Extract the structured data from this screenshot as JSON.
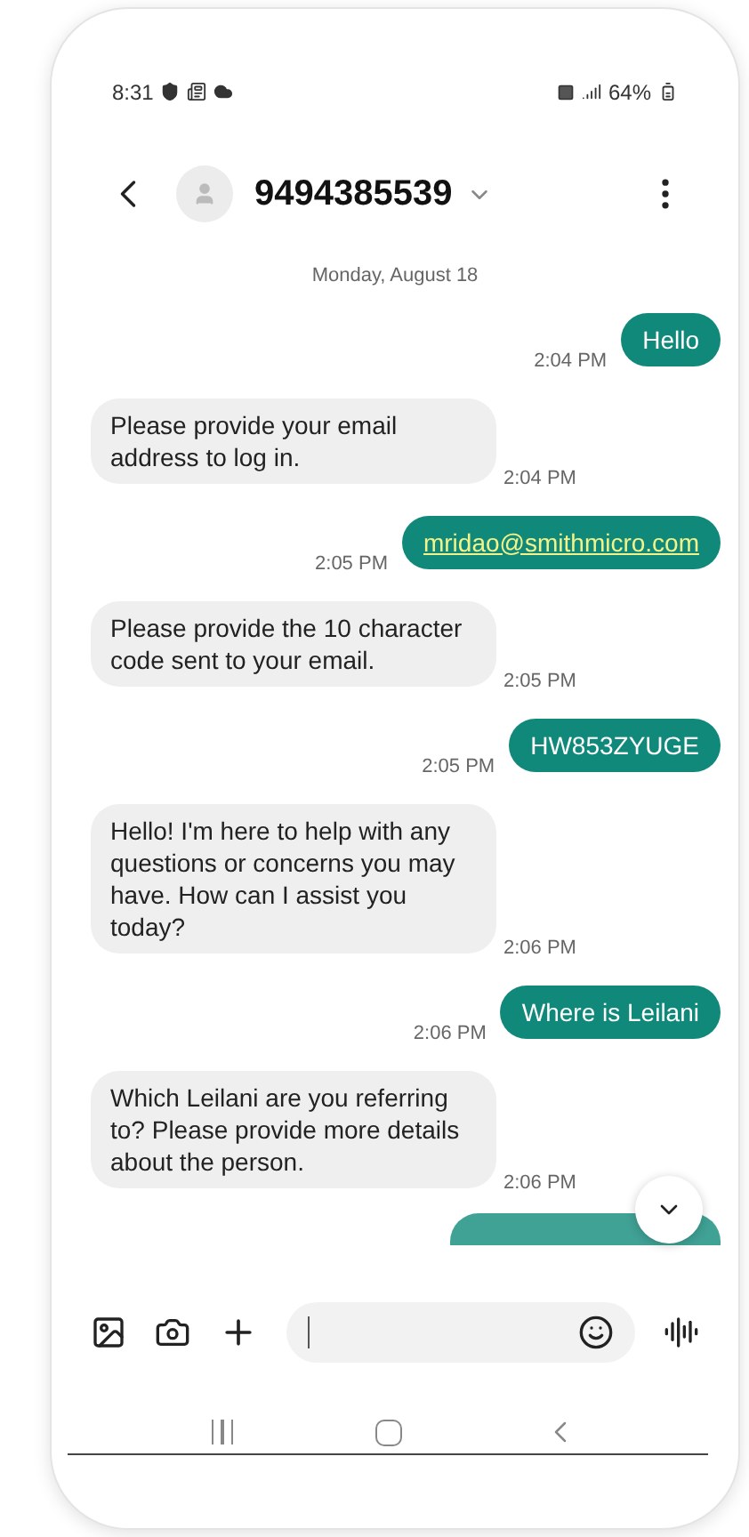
{
  "status_bar": {
    "time": "8:31",
    "battery": "64%"
  },
  "header": {
    "contact": "9494385539"
  },
  "date": "Monday, August 18",
  "messages": [
    {
      "kind": "outgoing",
      "text": "Hello",
      "time": "2:04 PM",
      "link": false
    },
    {
      "kind": "incoming",
      "text": "Please provide your email address to log in.",
      "time": "2:04 PM",
      "link": false
    },
    {
      "kind": "outgoing",
      "text": "mridao@smithmicro.com",
      "time": "2:05 PM",
      "link": true
    },
    {
      "kind": "incoming",
      "text": "Please provide the 10 character code sent to your email.",
      "time": "2:05 PM",
      "link": false
    },
    {
      "kind": "outgoing",
      "text": "HW853ZYUGE",
      "time": "2:05 PM",
      "link": false
    },
    {
      "kind": "incoming",
      "text": "Hello! I'm here to help with any questions or concerns you may have. How can I assist you today?",
      "time": "2:06 PM",
      "link": false
    },
    {
      "kind": "outgoing",
      "text": "Where is Leilani",
      "time": "2:06 PM",
      "link": false
    },
    {
      "kind": "incoming",
      "text": "Which Leilani are you referring to? Please provide more details about the person.",
      "time": "2:06 PM",
      "link": false
    }
  ]
}
